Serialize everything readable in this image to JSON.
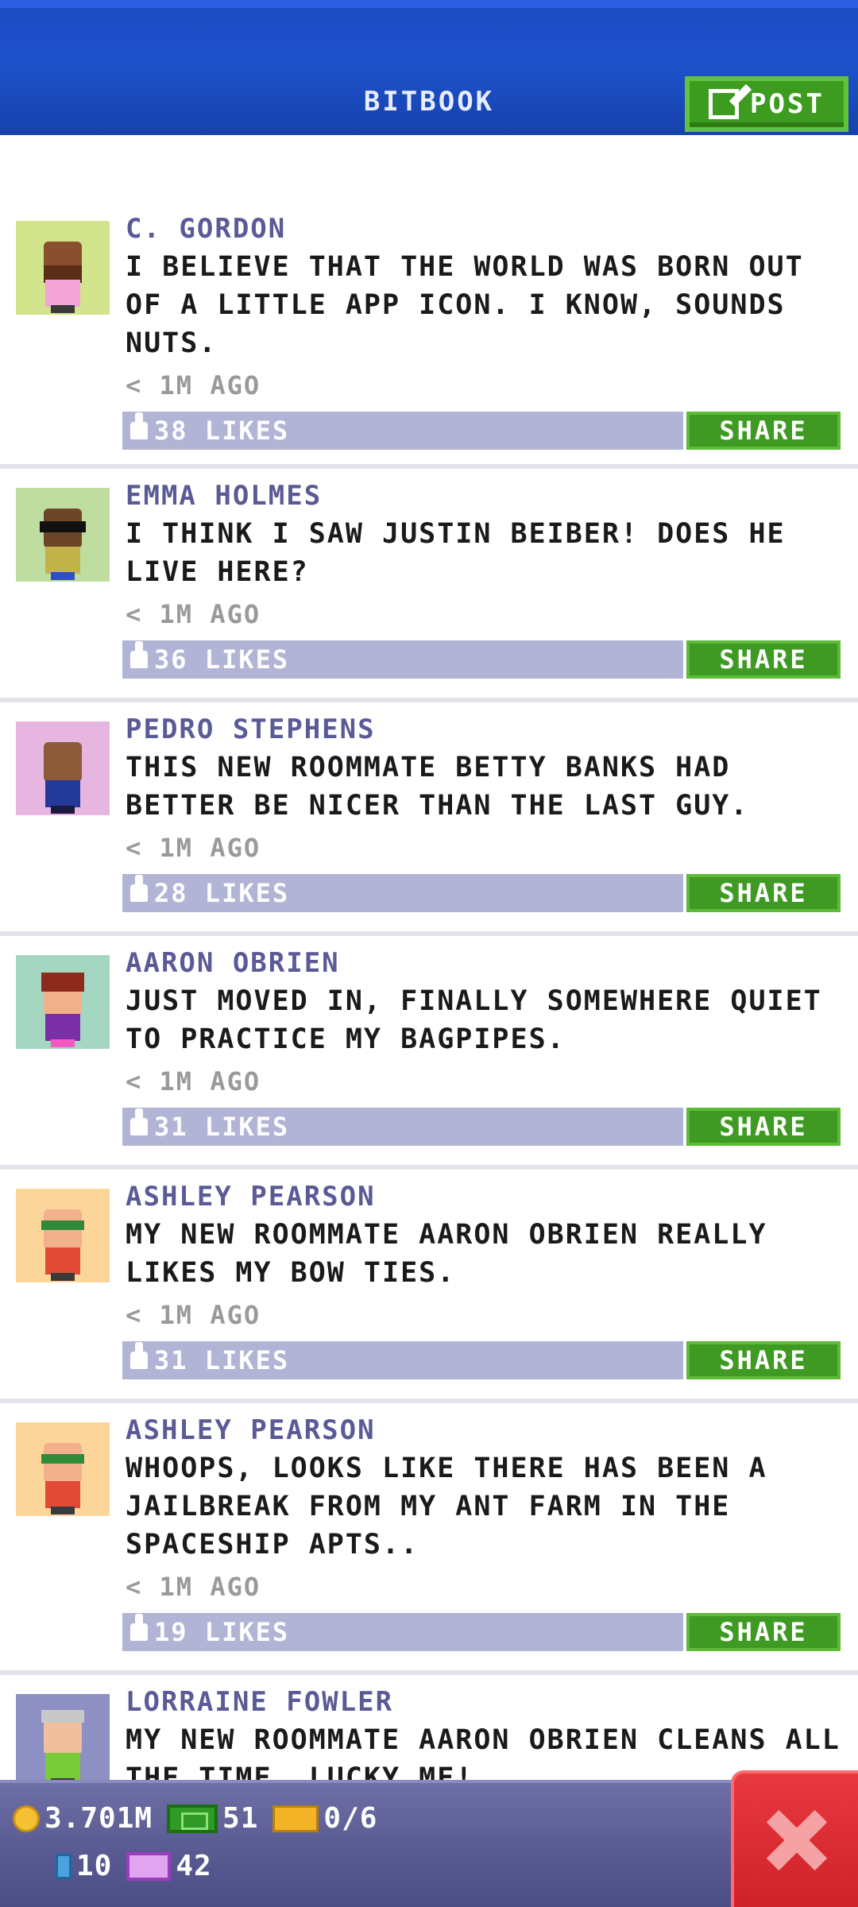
{
  "header": {
    "title": "BITBOOK",
    "post_label": "POST"
  },
  "colors": {
    "header_blue": "#1e52cc",
    "share_green": "#3e9a22",
    "likes_bar": "#b2b4d6",
    "author": "#5a5a96",
    "close_red": "#d8272e"
  },
  "posts": [
    {
      "author": "C. GORDON",
      "message": "I BELIEVE THAT THE WORLD WAS BORN OUT OF A LITTLE APP ICON. I KNOW, SOUNDS NUTS.",
      "time": "< 1M AGO",
      "likes": "38 LIKES",
      "share": "SHARE",
      "avatar_bg": "#d2e58c"
    },
    {
      "author": "EMMA HOLMES",
      "message": "I THINK I SAW JUSTIN BEIBER! DOES HE LIVE HERE?",
      "time": "< 1M AGO",
      "likes": "36 LIKES",
      "share": "SHARE",
      "avatar_bg": "#bedd9e"
    },
    {
      "author": "PEDRO STEPHENS",
      "message": "THIS NEW ROOMMATE BETTY BANKS HAD BETTER BE NICER THAN THE LAST GUY.",
      "time": "< 1M AGO",
      "likes": "28 LIKES",
      "share": "SHARE",
      "avatar_bg": "#e7b6e0"
    },
    {
      "author": "AARON OBRIEN",
      "message": "JUST MOVED IN, FINALLY SOMEWHERE QUIET TO PRACTICE MY BAGPIPES.",
      "time": "< 1M AGO",
      "likes": "31 LIKES",
      "share": "SHARE",
      "avatar_bg": "#a5d6c1"
    },
    {
      "author": "ASHLEY PEARSON",
      "message": "MY NEW ROOMMATE AARON OBRIEN REALLY LIKES MY BOW TIES.",
      "time": "< 1M AGO",
      "likes": "31 LIKES",
      "share": "SHARE",
      "avatar_bg": "#fcd59b"
    },
    {
      "author": "ASHLEY PEARSON",
      "message": "WHOOPS, LOOKS LIKE THERE HAS BEEN A JAILBREAK FROM MY ANT FARM IN THE SPACESHIP APTS..",
      "time": "< 1M AGO",
      "likes": "19 LIKES",
      "share": "SHARE",
      "avatar_bg": "#fcd59b"
    },
    {
      "author": "LORRAINE FOWLER",
      "message": "MY NEW ROOMMATE AARON OBRIEN CLEANS ALL THE TIME. LUCKY ME!",
      "avatar_bg": "#8e8fc2"
    }
  ],
  "resources": {
    "coins": "3.701M",
    "bux": "51",
    "tickets": "0/6",
    "items": "10",
    "vip": "42"
  }
}
